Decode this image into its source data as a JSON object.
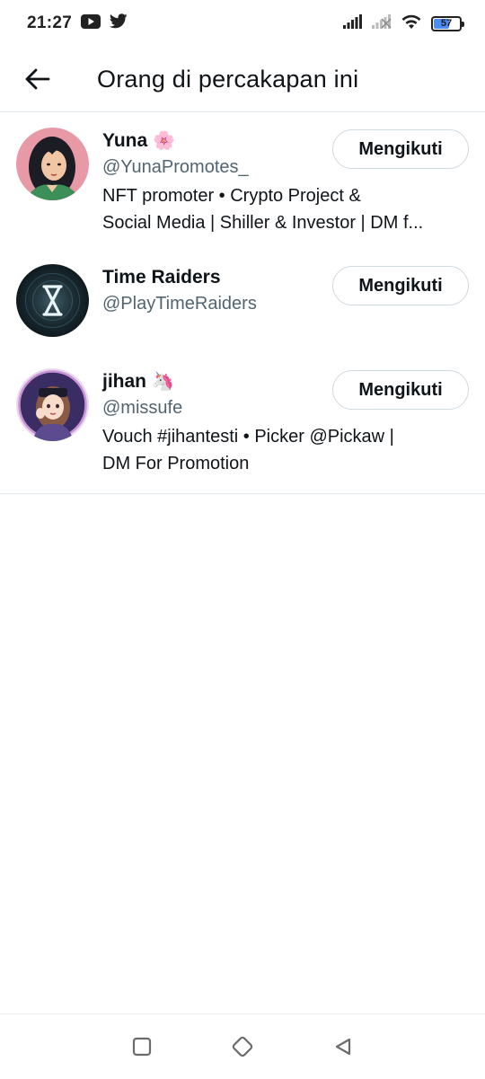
{
  "status_bar": {
    "time": "21:27",
    "battery_level": "57",
    "icons": [
      "youtube-icon",
      "twitter-icon",
      "signal-icon",
      "signal-no-icon",
      "wifi-icon",
      "battery-icon"
    ]
  },
  "header": {
    "title": "Orang di percakapan ini",
    "back_icon": "arrow-left-icon"
  },
  "users": [
    {
      "name": "Yuna",
      "emoji": "🌸",
      "handle": "@YunaPromotes_",
      "bio_line1": "NFT promoter • Crypto Project &",
      "bio_line2": "Social Media | Shiller & Investor | DM f...",
      "follow_label": "Mengikuti"
    },
    {
      "name": "Time Raiders",
      "emoji": "",
      "handle": "@PlayTimeRaiders",
      "bio_line1": "",
      "bio_line2": "",
      "follow_label": "Mengikuti"
    },
    {
      "name": "jihan",
      "emoji": "🦄",
      "handle": "@missufe",
      "bio_line1": "Vouch #jihantesti • Picker @Pickaw |",
      "bio_line2": "DM For Promotion",
      "follow_label": "Mengikuti"
    }
  ],
  "nav_bar": {
    "icons": [
      "recents-square-icon",
      "home-diamond-icon",
      "back-triangle-icon"
    ]
  },
  "colors": {
    "text_primary": "#0f1419",
    "text_secondary": "#536471",
    "divider": "#e1e8ed",
    "button_border": "#cfd9de"
  }
}
